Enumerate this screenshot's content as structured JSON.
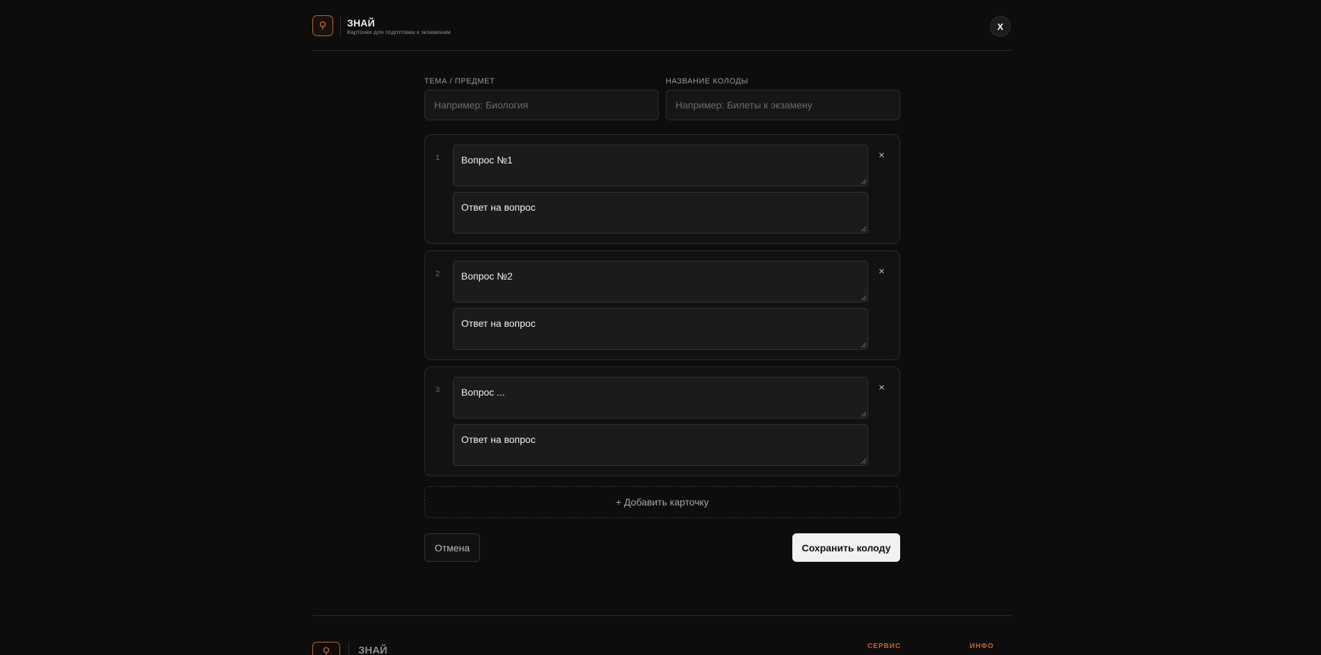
{
  "header": {
    "brand_name": "ЗНАЙ",
    "brand_subtitle": "Карточки для подготовки к экзаменам",
    "close_label": "X",
    "logo_icon": "lightbulb-icon"
  },
  "form": {
    "topic_label": "ТЕМА / ПРЕДМЕТ",
    "topic_placeholder": "Например: Биология",
    "topic_value": "",
    "deck_label": "НАЗВАНИЕ КОЛОДЫ",
    "deck_placeholder": "Например: Билеты к экзамену",
    "deck_value": ""
  },
  "cards": [
    {
      "number": "1",
      "question": "Вопрос №1",
      "answer": "Ответ на вопрос",
      "remove": "×"
    },
    {
      "number": "2",
      "question": "Вопрос №2",
      "answer": "Ответ на вопрос",
      "remove": "×"
    },
    {
      "number": "3",
      "question": "Вопрос ...",
      "answer": "Ответ на вопрос",
      "remove": "×"
    }
  ],
  "actions": {
    "add_card": "+ Добавить карточку",
    "cancel": "Отмена",
    "save": "Сохранить колоду"
  },
  "footer": {
    "brand_name": "ЗНАЙ",
    "link_service": "СЕРВИС",
    "link_info": "ИНФО"
  },
  "colors": {
    "accent": "#c8652e",
    "background": "#0d0d0e",
    "save_button": "#f1f1ef"
  }
}
